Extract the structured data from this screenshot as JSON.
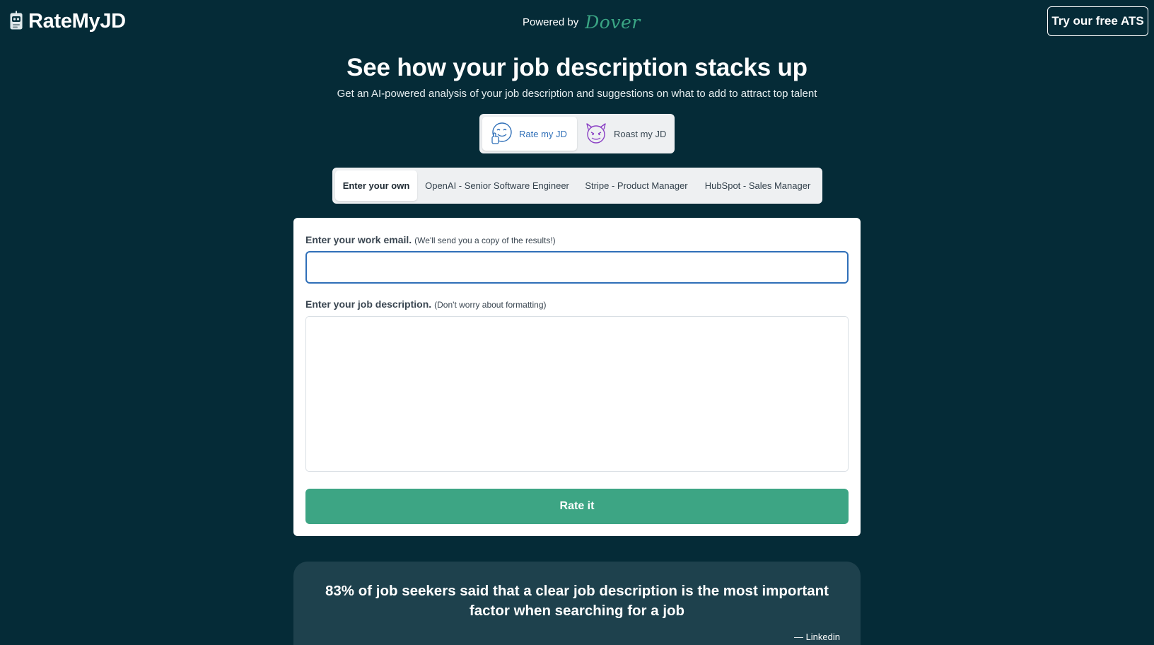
{
  "header": {
    "logo_text": "RateMyJD",
    "powered_by": "Powered by",
    "brand_word": "Dover",
    "ats_button": "Try our free ATS"
  },
  "hero": {
    "title": "See how your job description stacks up",
    "subtitle": "Get an AI-powered analysis of your job description and suggestions on what to add to attract top talent"
  },
  "mode_toggle": {
    "selected": "Rate my JD",
    "options": [
      {
        "label": "Rate my JD",
        "icon": "thumbs-up-face-icon"
      },
      {
        "label": "Roast my JD",
        "icon": "devil-face-icon"
      }
    ]
  },
  "tabs": {
    "selected": "Enter your own",
    "items": [
      "Enter your own",
      "OpenAI - Senior Software Engineer",
      "Stripe - Product Manager",
      "HubSpot - Sales Manager"
    ]
  },
  "form": {
    "email_label": "Enter your work email.",
    "email_hint": "(We'll send you a copy of the results!)",
    "email_value": "",
    "jd_label": "Enter your job description.",
    "jd_hint": "(Don't worry about formatting)",
    "jd_value": "",
    "submit_label": "Rate it"
  },
  "quote": {
    "text": "83% of job seekers said that a clear job description is the most important factor when searching for a job",
    "source": "— Linkedin"
  },
  "colors": {
    "background": "#052b37",
    "accent_green": "#3da584",
    "focus_blue": "#2f6fb8",
    "quote_card": "#1e414d"
  }
}
